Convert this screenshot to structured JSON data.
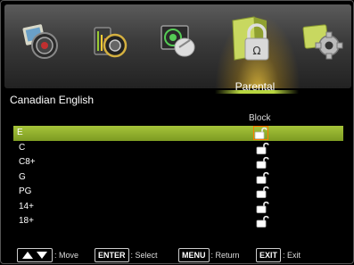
{
  "menu": {
    "tabs": [
      {
        "name": "picture",
        "icon": "picture-icon"
      },
      {
        "name": "sound",
        "icon": "sound-icon"
      },
      {
        "name": "channel",
        "icon": "satellite-dish-icon"
      },
      {
        "name": "parental",
        "icon": "lock-icon",
        "active": true
      },
      {
        "name": "setup",
        "icon": "gear-icon"
      }
    ],
    "active_label": "Parental"
  },
  "section": {
    "title": "Canadian English",
    "column_header": "Block"
  },
  "ratings": [
    {
      "label": "E",
      "blocked": false,
      "selected": true
    },
    {
      "label": "C",
      "blocked": false,
      "selected": false
    },
    {
      "label": "C8+",
      "blocked": false,
      "selected": false
    },
    {
      "label": "G",
      "blocked": false,
      "selected": false
    },
    {
      "label": "PG",
      "blocked": false,
      "selected": false
    },
    {
      "label": "14+",
      "blocked": false,
      "selected": false
    },
    {
      "label": "18+",
      "blocked": false,
      "selected": false
    }
  ],
  "footer": {
    "move": {
      "key": "arrows",
      "text": ": Move"
    },
    "select": {
      "key": "ENTER",
      "text": ": Select"
    },
    "return": {
      "key": "MENU",
      "text": ": Return"
    },
    "exit": {
      "key": "EXIT",
      "text": ": Exit"
    }
  },
  "colors": {
    "accent": "#a6c43a",
    "selection_outline": "#ff7a00",
    "glow": "#ffd23c"
  }
}
